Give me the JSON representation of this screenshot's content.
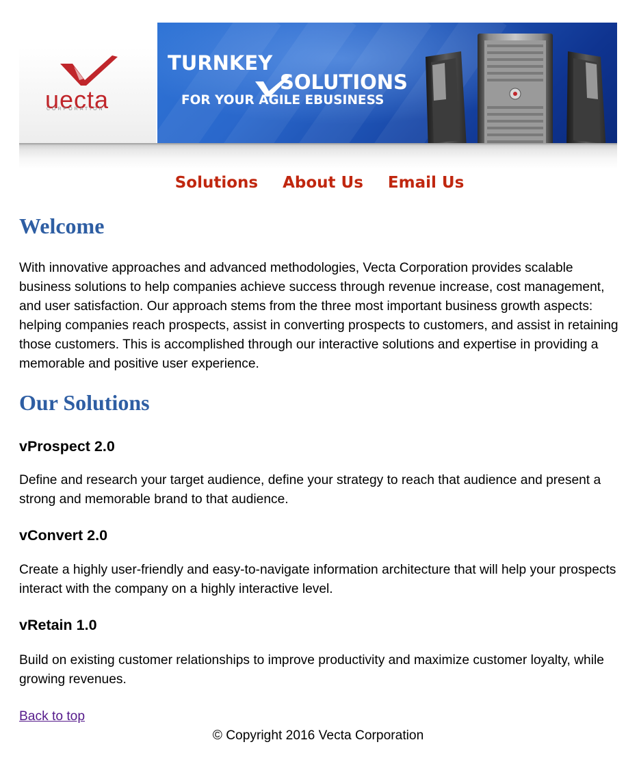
{
  "banner": {
    "logo_text": "uecta",
    "logo_sub": "CORPORATION",
    "tagline_1": "TURNKEY",
    "tagline_2": "SOLUTIONS",
    "tagline_3": "FOR YOUR AGILE EBUSINESS"
  },
  "nav": {
    "items": [
      {
        "label": "Solutions"
      },
      {
        "label": "About Us"
      },
      {
        "label": "Email Us"
      }
    ]
  },
  "welcome": {
    "title": "Welcome",
    "text": "With innovative approaches and advanced methodologies, Vecta Corporation provides scalable business solutions to help companies achieve success through revenue increase, cost management, and user satisfaction. Our approach stems from the three most important business growth aspects: helping companies reach prospects, assist in converting prospects to customers, and assist in retaining those customers. This is accomplished through our interactive solutions and expertise in providing a memorable and positive user experience."
  },
  "solutions": {
    "title": "Our Solutions",
    "items": [
      {
        "name": "vProspect 2.0",
        "description": "Define and research your target audience, define your strategy to reach that audience and present a strong and memorable brand to that audience."
      },
      {
        "name": "vConvert 2.0",
        "description": "Create a highly user-friendly and easy-to-navigate information architecture that will help your prospects interact with the company on a highly interactive level."
      },
      {
        "name": "vRetain 1.0",
        "description": "Build on existing customer relationships to improve productivity and maximize customer loyalty, while growing revenues."
      }
    ]
  },
  "footer": {
    "back_to_top": "Back to top",
    "copyright": "© Copyright 2016 Vecta Corporation"
  },
  "colors": {
    "nav_link": "#c0270f",
    "heading": "#2e5ea3",
    "logo_red": "#c0262b",
    "visited_link": "#551a8b"
  }
}
